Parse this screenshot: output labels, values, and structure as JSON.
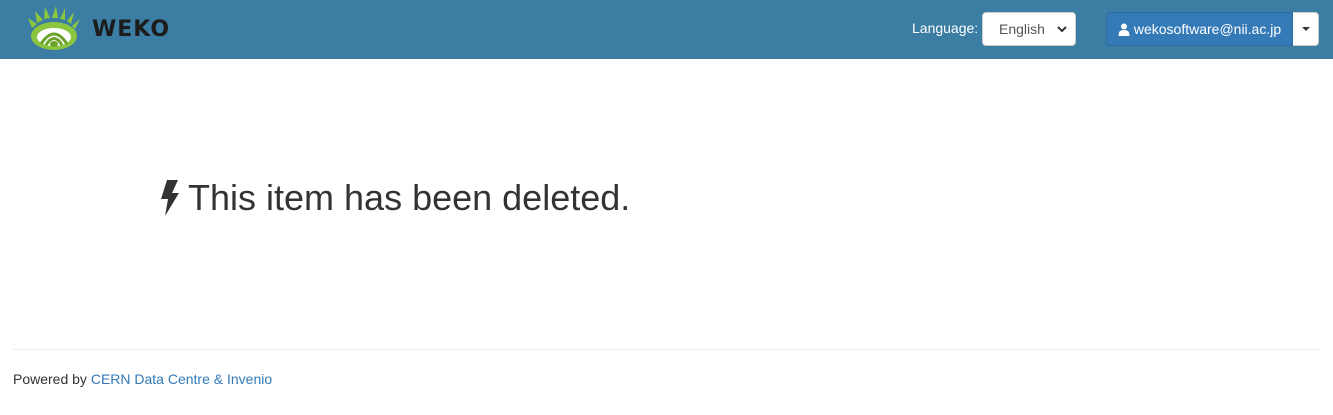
{
  "header": {
    "brand_name": "WEKO",
    "logo_icon": "weko-logo-icon",
    "background_color": "#3c7ea3",
    "language_label": "Language:",
    "language_selected": "English",
    "user_email": "wekosoftware@nii.ac.jp",
    "user_icon": "user-icon",
    "user_button_color": "#337ab7"
  },
  "main": {
    "icon": "bolt-icon",
    "message": "This item has been deleted."
  },
  "footer": {
    "powered_by": "Powered by",
    "link_text": "CERN Data Centre & Invenio",
    "link_color": "#337ab7"
  }
}
